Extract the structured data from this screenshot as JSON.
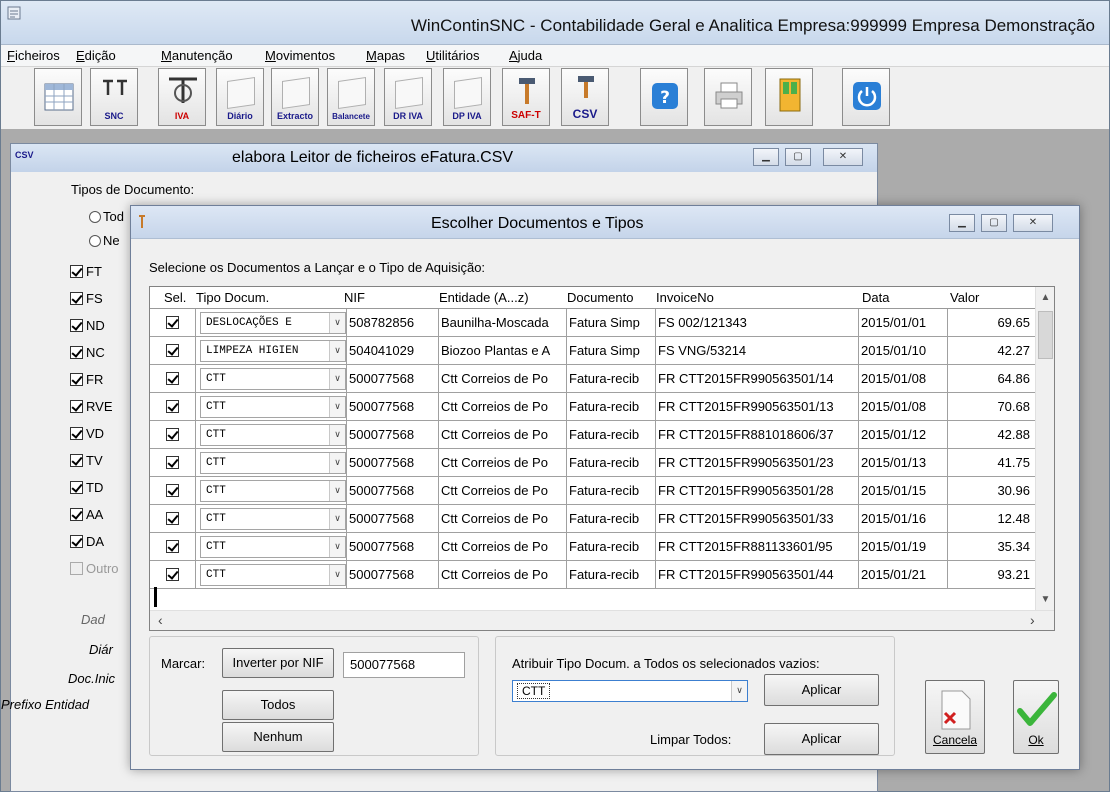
{
  "app": {
    "title": "WinContinSNC - Contabilidade Geral e Analitica Empresa:999999 Empresa Demonstração"
  },
  "menu": [
    "Ficheiros",
    "Edição",
    "Manutenção",
    "Movimentos",
    "Mapas",
    "Utilitários",
    "Ajuda"
  ],
  "toolbar": {
    "snc": "SNC",
    "iva": "IVA",
    "diario": "Diário",
    "extracto": "Extracto",
    "balancete": "Balancete",
    "dr_iva": "DR IVA",
    "dp_iva": "DP IVA",
    "saft": "SAF-T",
    "csv": "CSV"
  },
  "leitor": {
    "title": "elabora Leitor de ficheiros eFatura.CSV",
    "tipos_label": "Tipos de Documento:",
    "radio1": "Tod",
    "radio2": "Ne",
    "checks": [
      "FT",
      "FS",
      "ND",
      "NC",
      "FR",
      "RVE",
      "VD",
      "TV",
      "TD",
      "AA",
      "DA"
    ],
    "outro": "Outro",
    "side_labels": [
      "Dad",
      "Diár",
      "Doc.Inic",
      "Prefixo Entidad"
    ],
    "csv_icon_text": "CSV"
  },
  "dialog": {
    "title": "Escolher Documentos e Tipos",
    "instruction": "Selecione os Documentos a Lançar e o Tipo de Aquisição:",
    "columns": [
      "Sel.",
      "Tipo Docum.",
      "NIF",
      "Entidade (A...z)",
      "Documento",
      "InvoiceNo",
      "Data",
      "Valor"
    ],
    "rows": [
      {
        "tipo": "DESLOCAÇÕES E",
        "nif": "508782856",
        "entidade": "Baunilha-Moscada",
        "documento": "Fatura Simp",
        "invoice": "FS 002/121343",
        "data": "2015/01/01",
        "valor": "69.65"
      },
      {
        "tipo": "LIMPEZA HIGIEN",
        "nif": "504041029",
        "entidade": "Biozoo Plantas e A",
        "documento": "Fatura Simp",
        "invoice": "FS VNG/53214",
        "data": "2015/01/10",
        "valor": "42.27"
      },
      {
        "tipo": "CTT",
        "nif": "500077568",
        "entidade": "Ctt Correios de Po",
        "documento": "Fatura-recib",
        "invoice": "FR CTT2015FR990563501/14",
        "data": "2015/01/08",
        "valor": "64.86"
      },
      {
        "tipo": "CTT",
        "nif": "500077568",
        "entidade": "Ctt Correios de Po",
        "documento": "Fatura-recib",
        "invoice": "FR CTT2015FR990563501/13",
        "data": "2015/01/08",
        "valor": "70.68"
      },
      {
        "tipo": "CTT",
        "nif": "500077568",
        "entidade": "Ctt Correios de Po",
        "documento": "Fatura-recib",
        "invoice": "FR CTT2015FR881018606/37",
        "data": "2015/01/12",
        "valor": "42.88"
      },
      {
        "tipo": "CTT",
        "nif": "500077568",
        "entidade": "Ctt Correios de Po",
        "documento": "Fatura-recib",
        "invoice": "FR CTT2015FR990563501/23",
        "data": "2015/01/13",
        "valor": "41.75"
      },
      {
        "tipo": "CTT",
        "nif": "500077568",
        "entidade": "Ctt Correios de Po",
        "documento": "Fatura-recib",
        "invoice": "FR CTT2015FR990563501/28",
        "data": "2015/01/15",
        "valor": "30.96"
      },
      {
        "tipo": "CTT",
        "nif": "500077568",
        "entidade": "Ctt Correios de Po",
        "documento": "Fatura-recib",
        "invoice": "FR CTT2015FR990563501/33",
        "data": "2015/01/16",
        "valor": "12.48"
      },
      {
        "tipo": "CTT",
        "nif": "500077568",
        "entidade": "Ctt Correios de Po",
        "documento": "Fatura-recib",
        "invoice": "FR CTT2015FR881133601/95",
        "data": "2015/01/19",
        "valor": "35.34"
      },
      {
        "tipo": "CTT",
        "nif": "500077568",
        "entidade": "Ctt Correios de Po",
        "documento": "Fatura-recib",
        "invoice": "FR CTT2015FR990563501/44",
        "data": "2015/01/21",
        "valor": "93.21"
      }
    ],
    "marcar_label": "Marcar:",
    "inverter_label": "Inverter por NIF",
    "nif_value": "500077568",
    "todos_label": "Todos",
    "nenhum_label": "Nenhum",
    "atribuir_label": "Atribuir Tipo Docum. a Todos os selecionados vazios:",
    "tipo_select": "CTT",
    "aplicar_label": "Aplicar",
    "limpar_label": "Limpar Todos:",
    "aplicar2_label": "Aplicar",
    "cancela_label": "Cancela",
    "ok_label": "Ok"
  }
}
